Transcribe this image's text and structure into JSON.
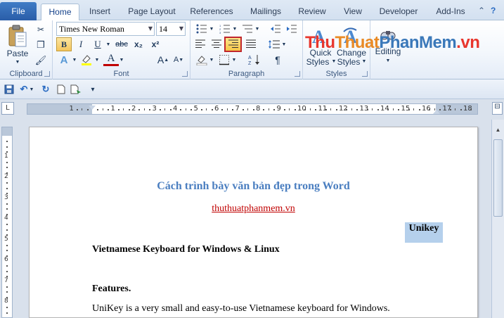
{
  "tabs": {
    "file": "File",
    "items": [
      "Home",
      "Insert",
      "Page Layout",
      "References",
      "Mailings",
      "Review",
      "View",
      "Developer",
      "Add-Ins"
    ],
    "active": "Home"
  },
  "ribbon": {
    "clipboard": {
      "paste": "Paste",
      "label": "Clipboard"
    },
    "font": {
      "font_name": "Times New Roman",
      "font_size": "14",
      "label": "Font",
      "bold": "B",
      "italic": "I",
      "underline": "U",
      "strike": "abc",
      "subscript": "x₂",
      "superscript": "x²",
      "grow": "A",
      "shrink": "A",
      "font_color": "A"
    },
    "paragraph": {
      "label": "Paragraph",
      "pilcrow": "¶"
    },
    "styles": {
      "quick_styles_line1": "Quick",
      "quick_styles_line2": "Styles",
      "change_styles_line1": "Change",
      "change_styles_line2": "Styles",
      "label": "Styles"
    },
    "editing": {
      "label": "Editing"
    }
  },
  "logo": {
    "part1": "Thu",
    "part2": "Thuat",
    "part3": "PhanMem",
    "part4": ".vn"
  },
  "ruler": {
    "numbers": [
      "1",
      "1",
      "2",
      "3",
      "4",
      "5",
      "6",
      "7",
      "8",
      "9",
      "10",
      "11",
      "12",
      "13",
      "14",
      "15",
      "16",
      "17",
      "18"
    ],
    "vertical_numbers": [
      "1",
      "2",
      "3",
      "4",
      "5",
      "6",
      "7",
      "8"
    ],
    "tab_selector": "L"
  },
  "document": {
    "title": "Cách trình bày văn bản đẹp trong Word",
    "link": "thuthuatphanmem.vn",
    "right_aligned": "Unikey",
    "heading": "Vietnamese Keyboard for Windows & Linux",
    "features": "Features.",
    "body": "UniKey is a very small and easy-to-use Vietnamese keyboard for Windows."
  },
  "colors": {
    "title_blue": "#4a7ec0",
    "link_red": "#c00000",
    "highlight": "#b5d0ec",
    "selected_border": "#c0262d"
  }
}
